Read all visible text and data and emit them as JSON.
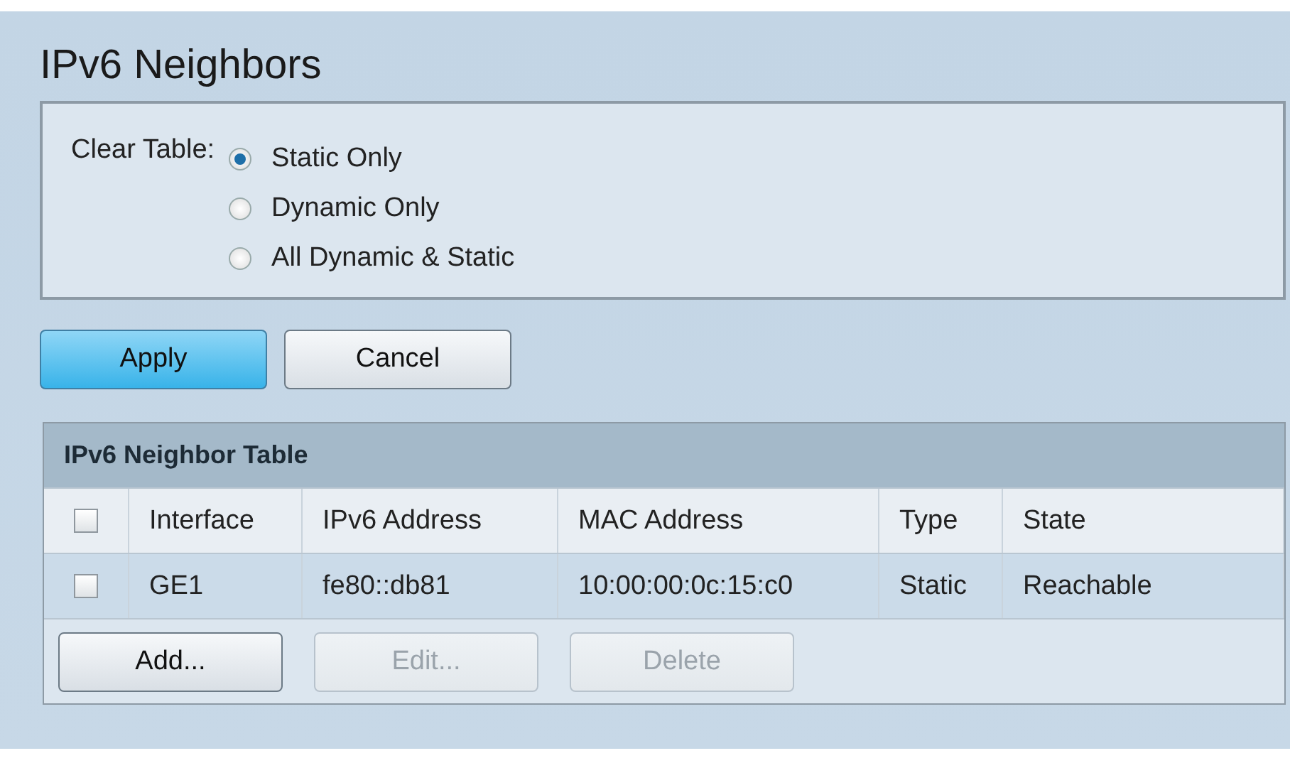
{
  "title": "IPv6 Neighbors",
  "clear_table": {
    "label": "Clear Table:",
    "options": [
      {
        "label": "Static Only",
        "selected": true
      },
      {
        "label": "Dynamic Only",
        "selected": false
      },
      {
        "label": "All Dynamic & Static",
        "selected": false
      }
    ]
  },
  "buttons": [
    {
      "label": "Apply",
      "kind": "primary"
    },
    {
      "label": "Cancel",
      "kind": "normal"
    }
  ],
  "table": {
    "title": "IPv6 Neighbor Table",
    "header_checked": false,
    "columns": [
      "Interface",
      "IPv6 Address",
      "MAC Address",
      "Type",
      "State"
    ],
    "rows": [
      {
        "checked": false,
        "cells": [
          "GE1",
          "fe80::db81",
          "10:00:00:0c:15:c0",
          "Static",
          "Reachable"
        ]
      }
    ],
    "buttons": [
      {
        "label": "Add...",
        "disabled": false
      },
      {
        "label": "Edit...",
        "disabled": true
      },
      {
        "label": "Delete",
        "disabled": true
      }
    ]
  }
}
